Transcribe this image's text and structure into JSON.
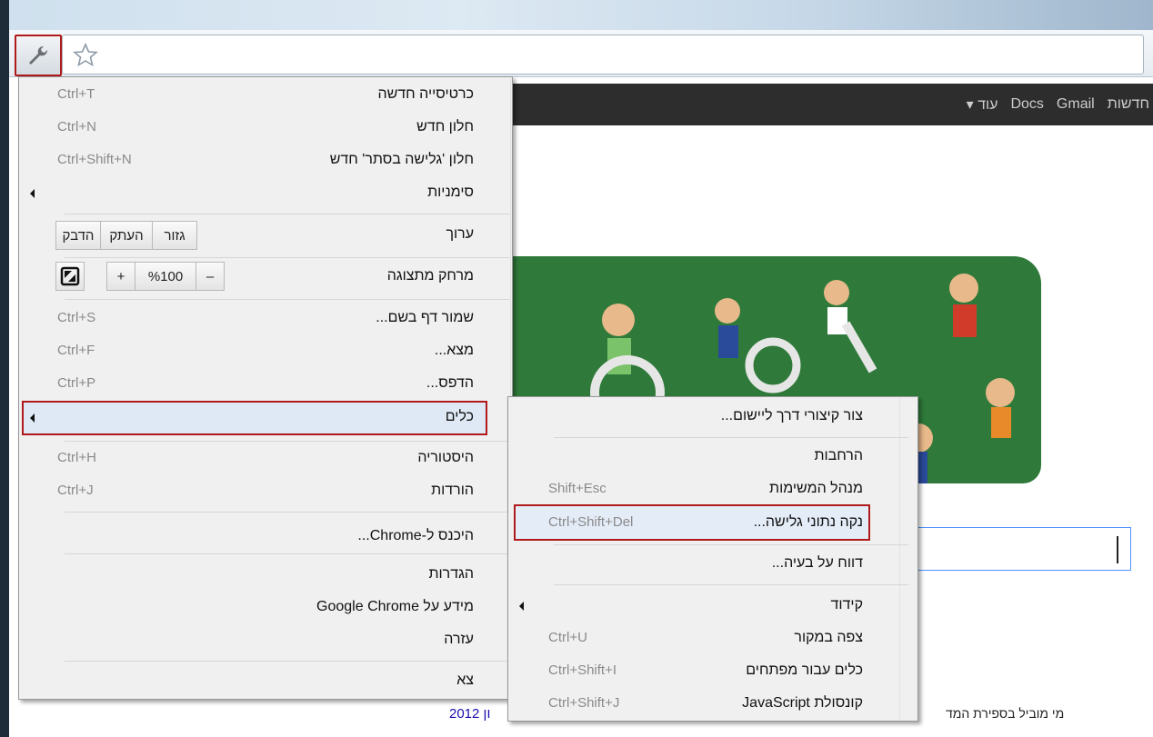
{
  "google_bar": {
    "links": [
      "חדשות",
      "Gmail",
      "Docs",
      "עוד ▾"
    ]
  },
  "menu": {
    "items": [
      {
        "label": "כרטיסייה חדשה",
        "shortcut": "Ctrl+T"
      },
      {
        "label": "חלון חדש",
        "shortcut": "Ctrl+N"
      },
      {
        "label": "חלון 'גלישה בסתר' חדש",
        "shortcut": "Ctrl+Shift+N"
      },
      {
        "label": "סימניות",
        "shortcut": ""
      },
      {
        "label": "ערוך",
        "shortcut": ""
      },
      {
        "label": "מרחק מתצוגה",
        "shortcut": ""
      },
      {
        "label": "שמור דף בשם...",
        "shortcut": "Ctrl+S"
      },
      {
        "label": "מצא...",
        "shortcut": "Ctrl+F"
      },
      {
        "label": "הדפס...",
        "shortcut": "Ctrl+P"
      },
      {
        "label": "כלים",
        "shortcut": ""
      },
      {
        "label": "היסטוריה",
        "shortcut": "Ctrl+H"
      },
      {
        "label": "הורדות",
        "shortcut": "Ctrl+J"
      },
      {
        "label": "היכנס ל-Chrome...",
        "shortcut": ""
      },
      {
        "label": "הגדרות",
        "shortcut": ""
      },
      {
        "label": "מידע על Google Chrome",
        "shortcut": ""
      },
      {
        "label": "עזרה",
        "shortcut": ""
      },
      {
        "label": "צא",
        "shortcut": ""
      }
    ],
    "edit_buttons": {
      "cut": "גזור",
      "copy": "העתק",
      "paste": "הדבק"
    },
    "zoom": {
      "minus": "–",
      "value": "%100",
      "plus": "+"
    }
  },
  "submenu": {
    "items": [
      {
        "label": "צור קיצורי דרך ליישום...",
        "shortcut": ""
      },
      {
        "label": "הרחבות",
        "shortcut": ""
      },
      {
        "label": "מנהל המשימות",
        "shortcut": "Shift+Esc"
      },
      {
        "label": "נקה נתוני גלישה...",
        "shortcut": "Ctrl+Shift+Del"
      },
      {
        "label": "דווח על בעיה...",
        "shortcut": ""
      },
      {
        "label": "קידוד",
        "shortcut": ""
      },
      {
        "label": "צפה במקור",
        "shortcut": "Ctrl+U"
      },
      {
        "label": "כלים עבור מפתחים",
        "shortcut": "Ctrl+Shift+I"
      },
      {
        "label": "קונסולת JavaScript",
        "shortcut": "Ctrl+Shift+J"
      }
    ]
  },
  "page": {
    "bottom_text": "מי מוביל בספירת המד",
    "bottom_link": "2012 ון"
  },
  "colors": {
    "highlight_border": "#b01a1a",
    "menu_bg": "#f0f0f0",
    "google_bar": "#2d2d2d",
    "doodle_green": "#2f7a3a"
  }
}
